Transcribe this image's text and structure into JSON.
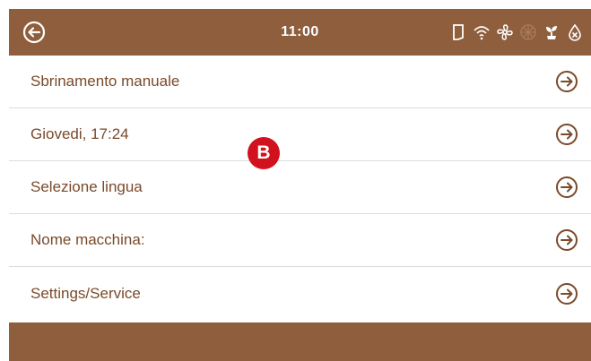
{
  "header": {
    "time": "11:00",
    "back_icon": "arrow-left-circle-icon",
    "status_icons": [
      "door-icon",
      "wifi-icon",
      "fan-icon",
      "defrost-icon",
      "plant-icon",
      "drop-alarm-icon"
    ]
  },
  "menu": {
    "items": [
      {
        "label": "Sbrinamento manuale"
      },
      {
        "label": "Giovedi, 17:24"
      },
      {
        "label": "Selezione lingua"
      },
      {
        "label": "Nome macchina:"
      },
      {
        "label": "Settings/Service"
      }
    ]
  },
  "marker": {
    "text": "B"
  },
  "colors": {
    "bar": "#8e5e3d",
    "text": "#7a4a2a",
    "marker": "#d1111d"
  }
}
